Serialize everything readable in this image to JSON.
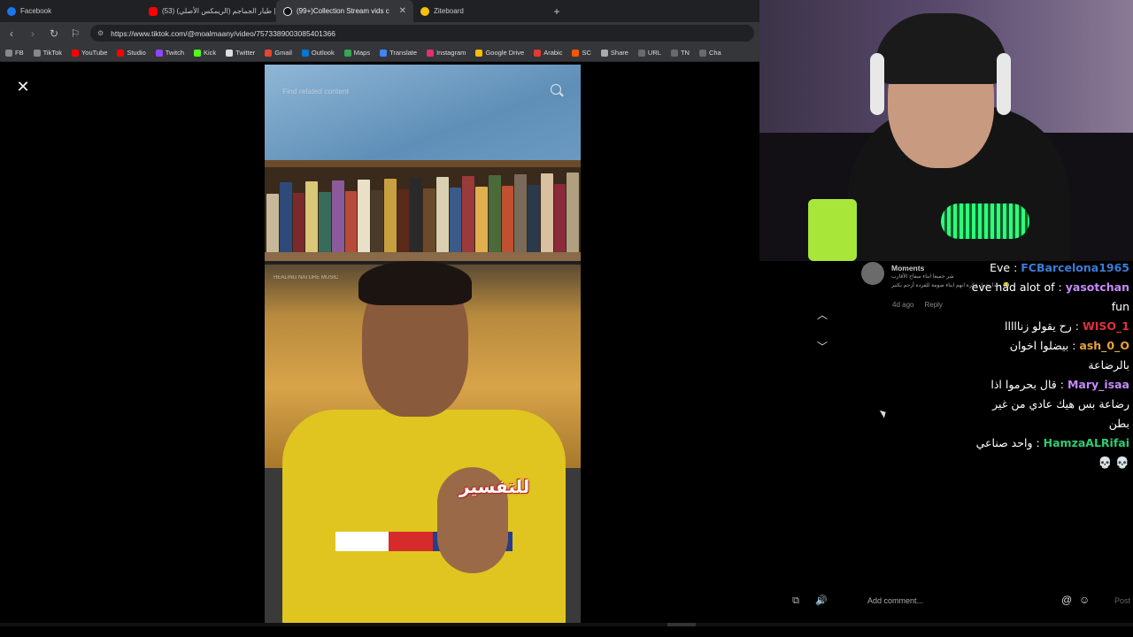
{
  "browser": {
    "tabs": [
      {
        "label": "Facebook",
        "favicon_color": "#1877f2",
        "icon": "facebook-icon",
        "active": false
      },
      {
        "label": "(53) طيار الجماجم (الريمكس الأصلي) |",
        "favicon_color": "#ff0000",
        "icon": "youtube-icon",
        "active": false
      },
      {
        "label": "(99+)Collection Stream vids c",
        "favicon_color": "#ffffff",
        "icon": "tiktok-icon",
        "active": true
      },
      {
        "label": "Ziteboard",
        "favicon_color": "#f4c20d",
        "icon": "ziteboard-icon",
        "active": false
      }
    ],
    "new_tab_label": "+",
    "url": "https://www.tiktok.com/@moalmaany/video/7573389003085401366",
    "bookmarks": [
      {
        "label": "FB",
        "color": "#888"
      },
      {
        "label": "TikTok",
        "color": "#888"
      },
      {
        "label": "YouTube",
        "color": "#ff0000"
      },
      {
        "label": "Studio",
        "color": "#ff0000"
      },
      {
        "label": "Twitch",
        "color": "#9146ff"
      },
      {
        "label": "Kick",
        "color": "#53fc18"
      },
      {
        "label": "Twitter",
        "color": "#dddddd"
      },
      {
        "label": "Gmail",
        "color": "#ea4335"
      },
      {
        "label": "Outlook",
        "color": "#0078d4"
      },
      {
        "label": "Maps",
        "color": "#34a853"
      },
      {
        "label": "Translate",
        "color": "#4285f4"
      },
      {
        "label": "Instagram",
        "color": "#e1306c"
      },
      {
        "label": "Google Drive",
        "color": "#fbbc04"
      },
      {
        "label": "Arabic",
        "color": "#e53935"
      },
      {
        "label": "SC",
        "color": "#ff5500"
      },
      {
        "label": "Share",
        "color": "#aaaaaa"
      },
      {
        "label": "URL",
        "color": "#6a6a6a"
      },
      {
        "label": "TN",
        "color": "#6a6a6a"
      },
      {
        "label": "Cha",
        "color": "#6a6a6a"
      }
    ]
  },
  "video": {
    "search_placeholder": "Find related content",
    "caption_overlay": "للتفسير",
    "watermark": "HEALING NATURE MUSIC"
  },
  "moments": {
    "title": "Moments",
    "preview_line1": "شر جميعا ابناء سفاح الأقارب",
    "preview_line2": "وهذا يجعل فكرة انهم ابناء صومة للقردة أرحم بكثير 😂",
    "time": "4d ago",
    "reply_label": "Reply"
  },
  "chat": [
    {
      "user": "FCBarcelona1965",
      "user_color": "#3b7dd8",
      "text": "Eve"
    },
    {
      "user": "yasotchan",
      "user_color": "#c58af9",
      "text": "eve had alot of fun"
    },
    {
      "user": "WISO_1",
      "user_color": "#e0303a",
      "text": "رح يقولو زنااااا"
    },
    {
      "user": "ash_0_O",
      "user_color": "#e8a23a",
      "text": "بيضلوا اخوان بالرضاعة"
    },
    {
      "user": "Mary_isaa",
      "user_color": "#c58af9",
      "text": "قال بحرموا اذا رضاعة بس هيك عادي من غير بطن"
    },
    {
      "user": "HamzaALRifai",
      "user_color": "#2ecc71",
      "text": "واحد صناعي 💀 💀"
    }
  ],
  "comment": {
    "placeholder": "Add comment...",
    "post_label": "Post"
  },
  "colors": {
    "background": "#000000",
    "chrome_dark": "#202124",
    "chrome_mid": "#35363a"
  }
}
